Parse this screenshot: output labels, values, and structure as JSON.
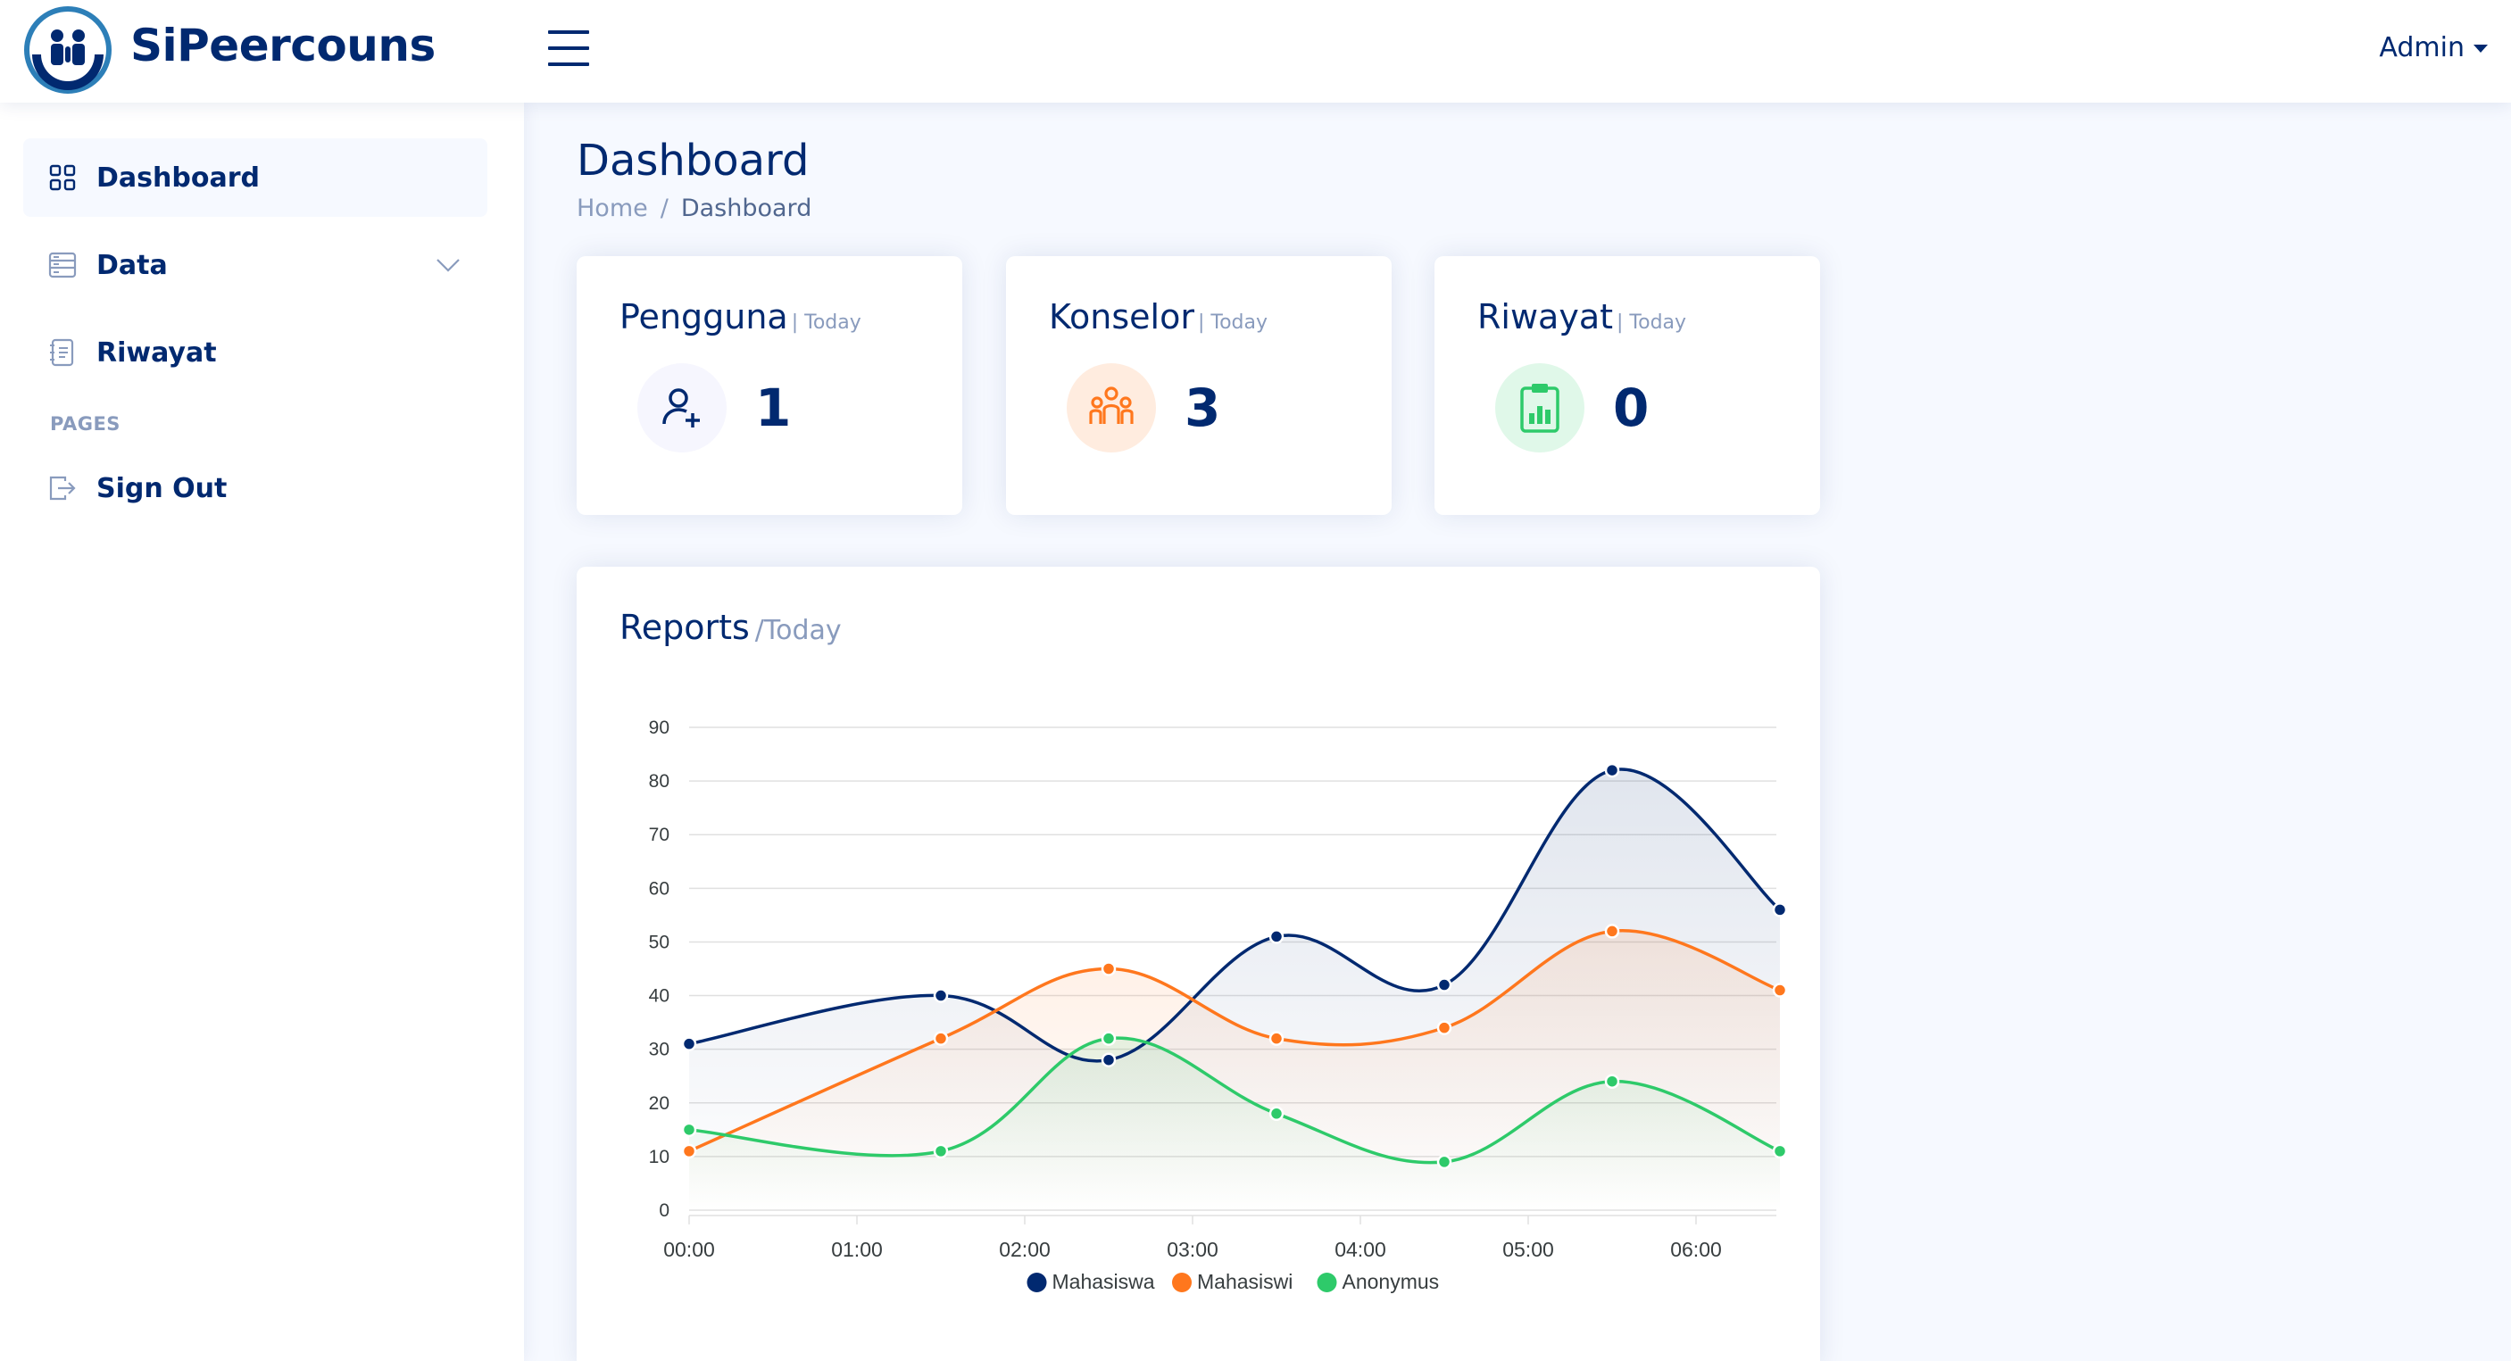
{
  "app": {
    "name": "SiPeercouns",
    "user_menu_label": "Admin"
  },
  "sidebar": {
    "items": [
      {
        "label": "Dashboard",
        "icon": "grid-icon"
      },
      {
        "label": "Data",
        "icon": "layout-text-icon"
      },
      {
        "label": "Riwayat",
        "icon": "journal-text-icon"
      }
    ],
    "pages_heading": "PAGES",
    "pages_items": [
      {
        "label": "Sign Out",
        "icon": "box-arrow-right-icon"
      }
    ]
  },
  "page": {
    "title": "Dashboard",
    "breadcrumb": [
      "Home",
      "/",
      "Dashboard"
    ]
  },
  "stats": [
    {
      "title": "Pengguna",
      "period": "| Today",
      "value": "1",
      "icon": "person-plus-icon",
      "color": "#012970",
      "bg": "#f6f6fe"
    },
    {
      "title": "Konselor",
      "period": "| Today",
      "value": "3",
      "icon": "people-icon",
      "color": "#ff771d",
      "bg": "#ffecdf"
    },
    {
      "title": "Riwayat",
      "period": "| Today",
      "value": "0",
      "icon": "clipboard-data-icon",
      "color": "#2eca6a",
      "bg": "#e0f8e9"
    }
  ],
  "reports": {
    "title": "Reports",
    "period": "/Today"
  },
  "chart_data": {
    "type": "area",
    "x": [
      "00:00",
      "01:30",
      "02:30",
      "03:30",
      "04:30",
      "05:30",
      "06:30"
    ],
    "x_ticks": [
      "00:00",
      "01:00",
      "02:00",
      "03:00",
      "04:00",
      "05:00",
      "06:00"
    ],
    "ylim": [
      0,
      90
    ],
    "y_ticks": [
      0,
      10,
      20,
      30,
      40,
      50,
      60,
      70,
      80,
      90
    ],
    "grid": true,
    "legend_position": "bottom",
    "series": [
      {
        "name": "Mahasiswa",
        "color": "#012970",
        "values": [
          31,
          40,
          28,
          51,
          42,
          82,
          56
        ]
      },
      {
        "name": "Mahasiswi",
        "color": "#ff771d",
        "values": [
          11,
          32,
          45,
          32,
          34,
          52,
          41
        ]
      },
      {
        "name": "Anonymus",
        "color": "#2eca6a",
        "values": [
          15,
          11,
          32,
          18,
          9,
          24,
          11
        ]
      }
    ]
  }
}
